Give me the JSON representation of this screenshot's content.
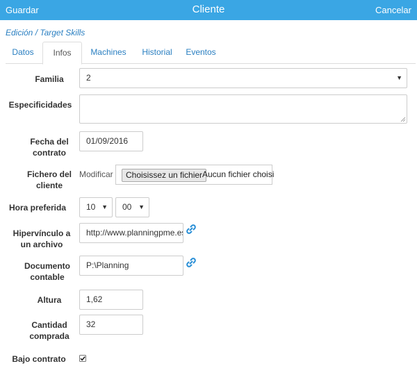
{
  "header": {
    "save_label": "Guardar",
    "title": "Cliente",
    "cancel_label": "Cancelar"
  },
  "breadcrumb": "Edición / Target Skills",
  "tabs": [
    {
      "label": "Datos"
    },
    {
      "label": "Infos"
    },
    {
      "label": "Machines"
    },
    {
      "label": "Historial"
    },
    {
      "label": "Eventos"
    }
  ],
  "form": {
    "familia": {
      "label": "Familia",
      "value": "2"
    },
    "especificidades": {
      "label": "Especificidades",
      "value": ""
    },
    "fecha": {
      "label_line1": "Fecha del",
      "label_line2": "contrato",
      "value": "01/09/2016"
    },
    "fichero": {
      "label_line1": "Fichero del",
      "label_line2": "cliente",
      "modify_text": "Modificar",
      "button_label": "Choisissez un fichier",
      "status": "Aucun fichier choisi"
    },
    "hora": {
      "label": "Hora preferida",
      "hour": "10",
      "minute": "00"
    },
    "hipervinculo": {
      "label_line1": "Hipervínculo a",
      "label_line2": "un archivo",
      "value": "http://www.planningpme.es"
    },
    "documento": {
      "label_line1": "Documento",
      "label_line2": "contable",
      "value": "P:\\Planning"
    },
    "altura": {
      "label": "Altura",
      "value": "1,62"
    },
    "cantidad": {
      "label_line1": "Cantidad",
      "label_line2": "comprada",
      "value": "32"
    },
    "bajo_contrato": {
      "label": "Bajo contrato",
      "checked": true
    }
  },
  "colors": {
    "header_bg": "#3aa6e4",
    "link": "#2a7fc1"
  },
  "icons": {
    "link": "link-icon",
    "select_arrow": "chevron-down-icon"
  }
}
